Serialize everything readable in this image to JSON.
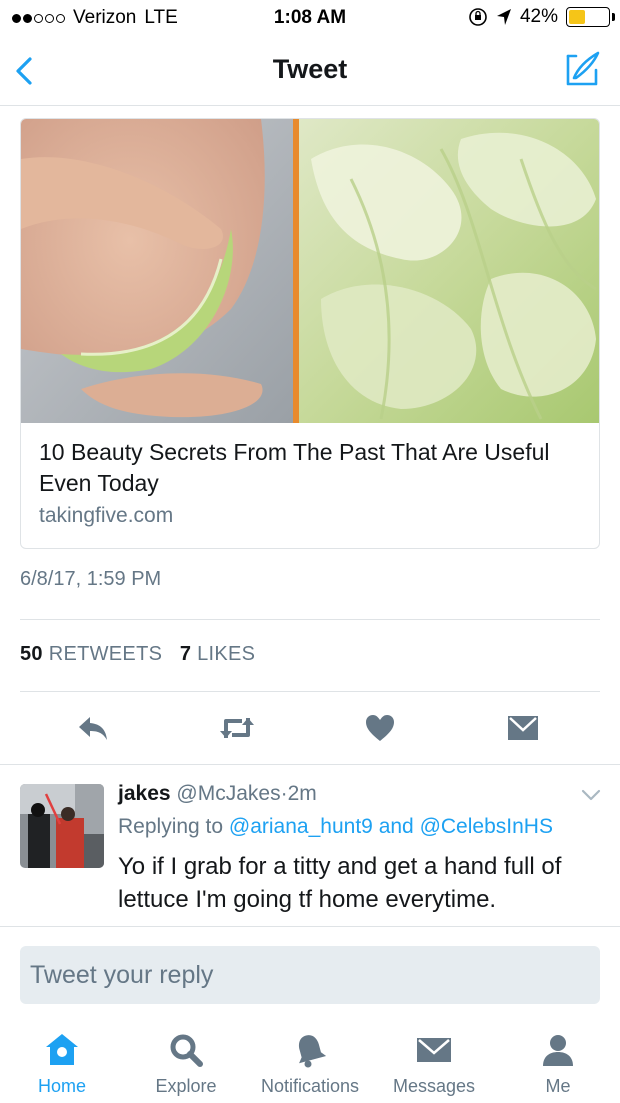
{
  "status_bar": {
    "carrier": "Verizon",
    "network": "LTE",
    "time": "1:08 AM",
    "battery_percent": "42%",
    "battery_level": 0.42,
    "signal_bars_filled": 2,
    "signal_bars_total": 5
  },
  "nav": {
    "title": "Tweet",
    "back_icon": "chevron-left-icon",
    "compose_icon": "compose-icon"
  },
  "card": {
    "title": "10 Beauty Secrets From The Past That Are Useful Even Today",
    "domain": "takingfive.com"
  },
  "tweet": {
    "timestamp": "6/8/17, 1:59 PM",
    "retweets_count": "50",
    "retweets_label": "RETWEETS",
    "likes_count": "7",
    "likes_label": "LIKES"
  },
  "actions": {
    "reply_icon": "reply-icon",
    "retweet_icon": "retweet-icon",
    "like_icon": "heart-icon",
    "dm_icon": "envelope-icon"
  },
  "reply": {
    "name": "jakes",
    "handle": "@McJakes",
    "separator": "·",
    "time": "2m",
    "replying_prefix": "Replying to",
    "mention1": "@ariana_hunt9",
    "conjunction": "and",
    "mention2": "@CelebsInHS",
    "text": "Yo if I grab for a titty and get a hand full of lettuce I'm going tf home everytime."
  },
  "composer": {
    "placeholder": "Tweet your reply"
  },
  "tab_bar": {
    "tabs": [
      {
        "label": "Home",
        "icon": "home-icon",
        "active": true
      },
      {
        "label": "Explore",
        "icon": "search-icon",
        "active": false
      },
      {
        "label": "Notifications",
        "icon": "bell-icon",
        "active": false
      },
      {
        "label": "Messages",
        "icon": "envelope-icon",
        "active": false
      },
      {
        "label": "Me",
        "icon": "person-icon",
        "active": false
      }
    ]
  },
  "colors": {
    "accent": "#1da1f2",
    "muted": "#657786",
    "text": "#14171a",
    "divider": "#dfe3e6",
    "battery": "#f5c518"
  }
}
